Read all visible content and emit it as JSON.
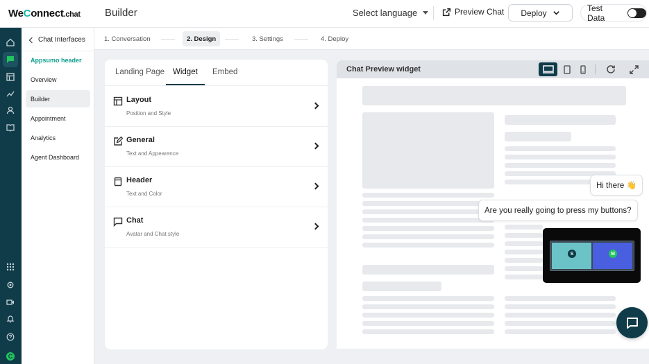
{
  "brand": {
    "prefix": "We",
    "accent": "C",
    "rest": "onnect",
    "suffix": ".chat",
    "accent_color": "#14b8a6"
  },
  "header": {
    "title": "Builder",
    "language": "Select language",
    "preview_chat": "Preview Chat",
    "deploy": "Deploy",
    "test_data": "Test Data"
  },
  "rail_icons": [
    "home-icon",
    "chat-icon",
    "layout-icon",
    "analytics-icon",
    "user-icon",
    "book-icon",
    "apps-icon",
    "settings-icon",
    "video-icon",
    "bell-icon",
    "help-icon",
    "brand-logo-icon"
  ],
  "subnav": {
    "back": "Chat Interfaces",
    "items": [
      {
        "label": "Appsumo header",
        "style": "teal"
      },
      {
        "label": "Overview"
      },
      {
        "label": "Builder",
        "active": true
      },
      {
        "label": "Appointment"
      },
      {
        "label": "Analytics"
      },
      {
        "label": "Agent Dashboard"
      }
    ]
  },
  "steps": [
    {
      "label": "1. Conversation"
    },
    {
      "label": "2. Design",
      "active": true
    },
    {
      "label": "3. Settings"
    },
    {
      "label": "4. Deploy"
    }
  ],
  "design": {
    "tabs": [
      "Landing Page",
      "Widget",
      "Embed"
    ],
    "active_tab": "Widget",
    "sections": [
      {
        "title": "Layout",
        "subtitle": "Position and Style",
        "icon": "layout-icon"
      },
      {
        "title": "General",
        "subtitle": "Text and Appearence",
        "icon": "edit-icon"
      },
      {
        "title": "Header",
        "subtitle": "Text and Color",
        "icon": "header-icon"
      },
      {
        "title": "Chat",
        "subtitle": "Avatar and Chat style",
        "icon": "message-icon"
      }
    ]
  },
  "preview": {
    "title": "Chat Preview widget",
    "tools": [
      "desktop-icon",
      "tablet-icon",
      "mobile-icon",
      "refresh-icon",
      "expand-icon"
    ],
    "bubble1": "Hi there 👋",
    "bubble2": "Are you really going to press my buttons?",
    "video_avatars": [
      "S",
      "M"
    ]
  },
  "colors": {
    "primary": "#103c4a",
    "accent": "#14b8a6",
    "active_item_text": "#0f9f8e"
  }
}
